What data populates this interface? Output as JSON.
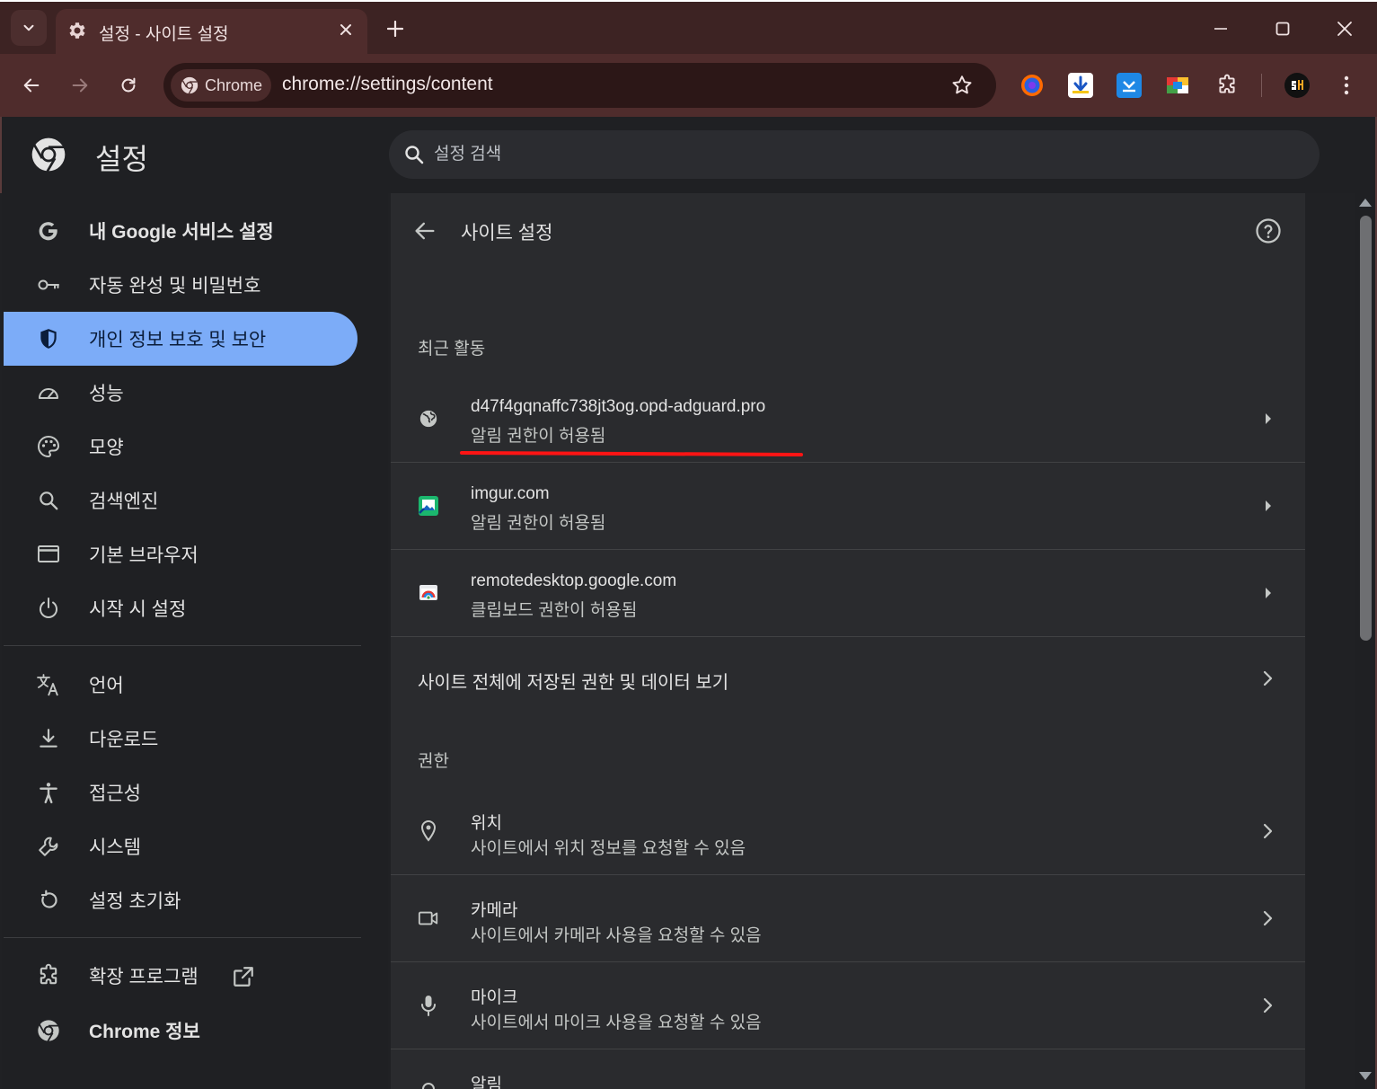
{
  "tab": {
    "title": "설정 - 사이트 설정",
    "icon": "gear-icon"
  },
  "toolbar": {
    "chip_label": "Chrome",
    "url": "chrome://settings/content",
    "extensions": [
      "firefox-extension-icon",
      "download-extension-icon",
      "save-extension-icon",
      "color-extension-icon",
      "puzzle-icon",
      "profile-avatar-icon"
    ]
  },
  "settings": {
    "title": "설정",
    "search_placeholder": "설정 검색"
  },
  "sidebar": {
    "items": [
      {
        "label": "내 Google 서비스 설정",
        "icon": "google-icon",
        "active": false
      },
      {
        "label": "자동 완성 및 비밀번호",
        "icon": "key-icon",
        "active": false
      },
      {
        "label": "개인 정보 보호 및 보안",
        "icon": "shield-icon",
        "active": true
      },
      {
        "label": "성능",
        "icon": "speedometer-icon",
        "active": false
      },
      {
        "label": "모양",
        "icon": "palette-icon",
        "active": false
      },
      {
        "label": "검색엔진",
        "icon": "search-icon",
        "active": false
      },
      {
        "label": "기본 브라우저",
        "icon": "browser-window-icon",
        "active": false
      },
      {
        "label": "시작 시 설정",
        "icon": "power-icon",
        "active": false
      },
      {
        "label": "언어",
        "icon": "translate-icon",
        "active": false
      },
      {
        "label": "다운로드",
        "icon": "download-icon",
        "active": false
      },
      {
        "label": "접근성",
        "icon": "accessibility-icon",
        "active": false
      },
      {
        "label": "시스템",
        "icon": "wrench-icon",
        "active": false
      },
      {
        "label": "설정 초기화",
        "icon": "reset-icon",
        "active": false
      },
      {
        "label": "확장 프로그램",
        "icon": "puzzle-icon",
        "active": false
      },
      {
        "label": "Chrome 정보",
        "icon": "chrome-icon",
        "active": false
      }
    ]
  },
  "main": {
    "page_title": "사이트 설정",
    "recent_section": "최근 활동",
    "recent": [
      {
        "site": "d47f4gqnaffc738jt3og.opd-adguard.pro",
        "status": "알림 권한이 허용됨",
        "icon": "globe-icon"
      },
      {
        "site": "imgur.com",
        "status": "알림 권한이 허용됨",
        "icon": "imgur-favicon"
      },
      {
        "site": "remotedesktop.google.com",
        "status": "클립보드 권한이 허용됨",
        "icon": "remote-desktop-favicon"
      }
    ],
    "all_sites": "사이트 전체에 저장된 권한 및 데이터 보기",
    "permissions_section": "권한",
    "permissions": [
      {
        "title": "위치",
        "desc": "사이트에서 위치 정보를 요청할 수 있음",
        "icon": "location-icon"
      },
      {
        "title": "카메라",
        "desc": "사이트에서 카메라 사용을 요청할 수 있음",
        "icon": "camera-icon"
      },
      {
        "title": "마이크",
        "desc": "사이트에서 마이크 사용을 요청할 수 있음",
        "icon": "microphone-icon"
      },
      {
        "title": "알림",
        "desc": "",
        "icon": "bell-icon"
      }
    ]
  },
  "colors": {
    "frame": "#3d2323",
    "toolbar": "#4f2c2c",
    "active_nav": "#7cacf8",
    "annotation_underline": "#ff1414"
  }
}
